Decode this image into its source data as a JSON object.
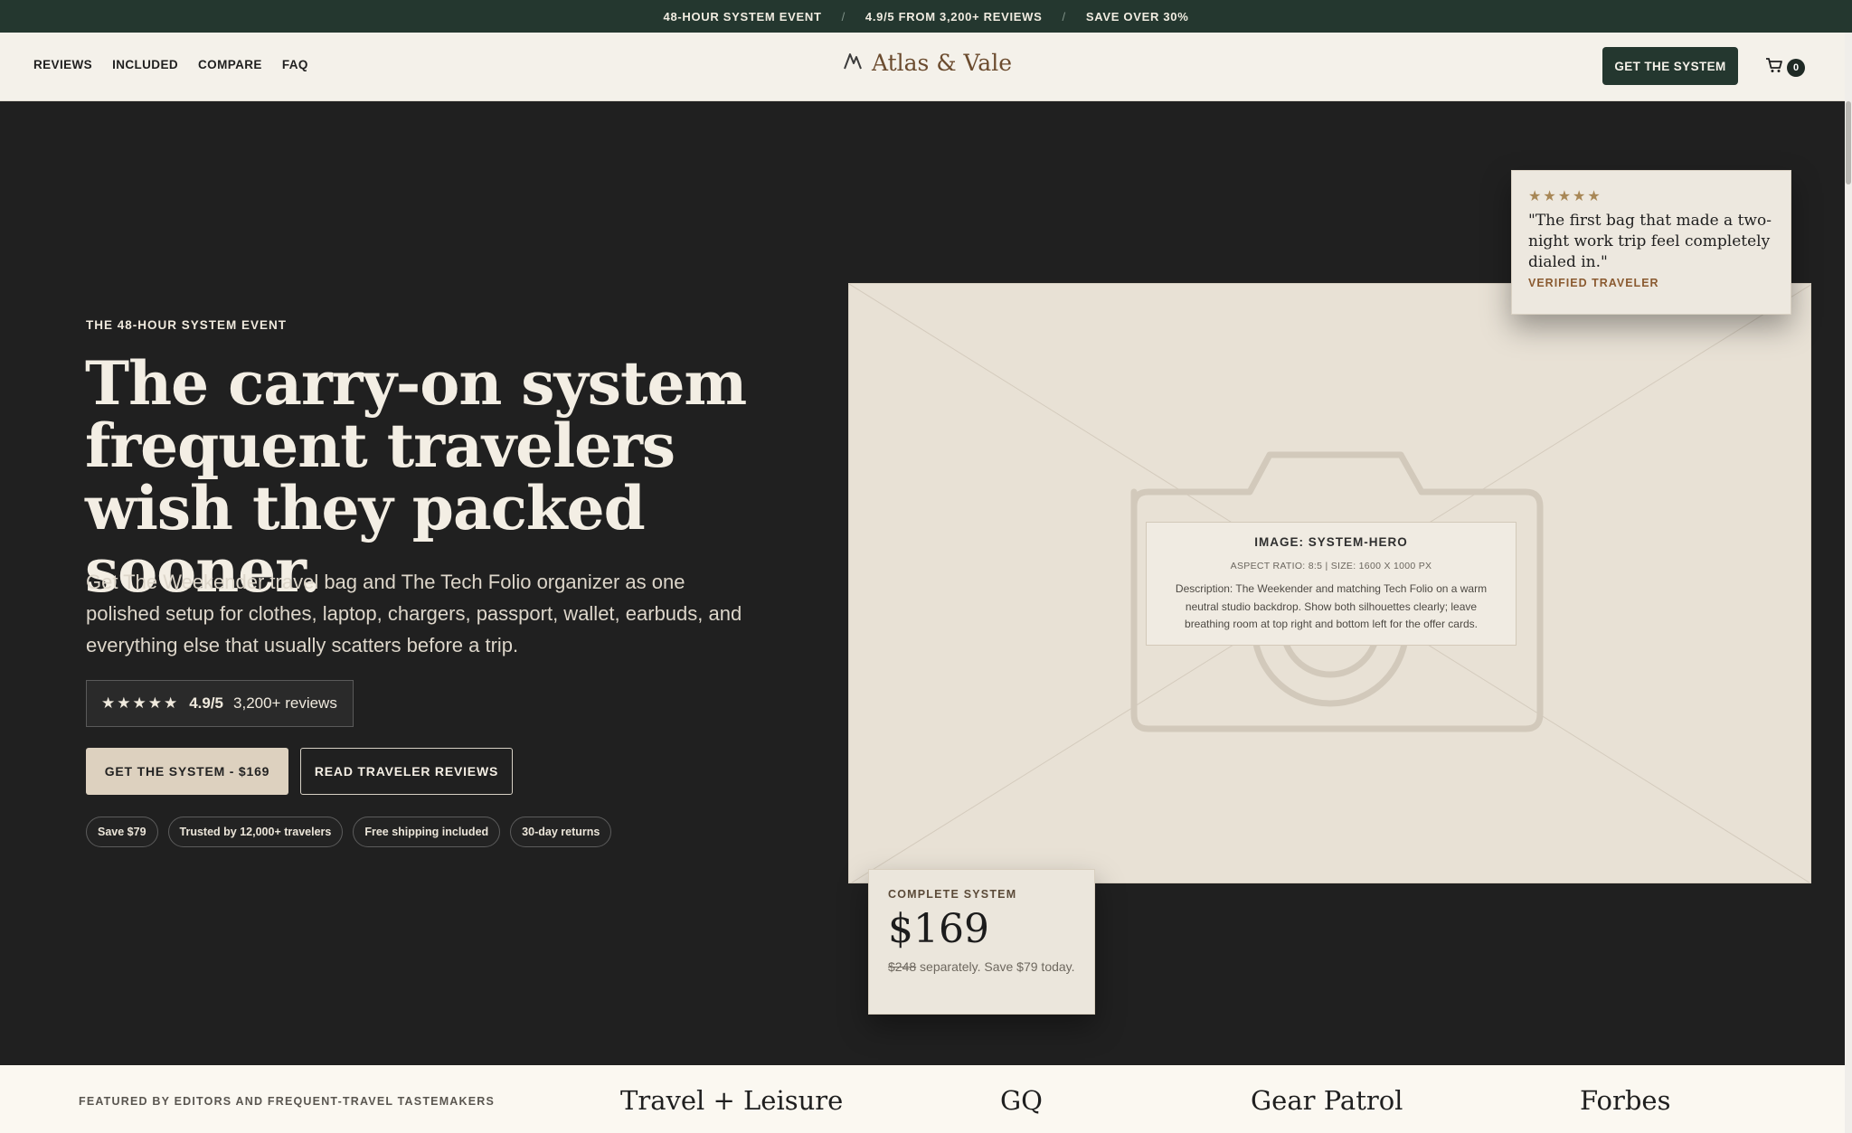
{
  "announcement": {
    "items": [
      "48-HOUR SYSTEM EVENT",
      "4.9/5 FROM 3,200+ REVIEWS",
      "SAVE OVER 30%"
    ],
    "separator": "/"
  },
  "header": {
    "nav": [
      "REVIEWS",
      "INCLUDED",
      "COMPARE",
      "FAQ"
    ],
    "brand": "Atlas & Vale",
    "cta": "GET THE SYSTEM",
    "cart_count": "0",
    "icons": {
      "logo": "mountain-peak-icon",
      "cart": "cart-icon"
    }
  },
  "hero": {
    "eyebrow": "THE 48-HOUR SYSTEM EVENT",
    "headline": "The carry-on system frequent travelers wish they packed sooner.",
    "subcopy": "Get The Weekender travel bag and The Tech Folio organizer as one polished setup for clothes, laptop, chargers, passport, wallet, earbuds, and everything else that usually scatters before a trip.",
    "rating": {
      "stars": "★★★★★",
      "score": "4.9/5",
      "count": "3,200+ reviews"
    },
    "primary_cta": "GET THE SYSTEM - $169",
    "secondary_cta": "READ TRAVELER REVIEWS",
    "badges": [
      "Save $79",
      "Trusted by 12,000+ travelers",
      "Free shipping included",
      "30-day returns"
    ]
  },
  "image_placeholder": {
    "title": "IMAGE: SYSTEM-HERO",
    "meta": "ASPECT RATIO: 8:5 | SIZE: 1600 X 1000 PX",
    "description": "Description: The Weekender and matching Tech Folio on a warm neutral studio backdrop. Show both silhouettes clearly; leave breathing room at top right and bottom left for the offer cards."
  },
  "review_card": {
    "stars": "★★★★★",
    "quote": "\"The first bag that made a two-night work trip feel completely dialed in.\"",
    "author": "VERIFIED TRAVELER"
  },
  "price_card": {
    "label": "COMPLETE SYSTEM",
    "price": "$169",
    "original": "$248",
    "note": " separately. Save $79 today."
  },
  "press": {
    "label": "FEATURED BY EDITORS AND FREQUENT-TRAVEL TASTEMAKERS",
    "logos": [
      "Travel + Leisure",
      "GQ",
      "Gear Patrol",
      "Forbes"
    ]
  },
  "colors": {
    "announcement_bg": "#24372f",
    "header_bg": "#f4f1ea",
    "hero_bg": "#202020",
    "accent_brown": "#6b4b2e",
    "cta_cream": "#ddd1bf"
  }
}
